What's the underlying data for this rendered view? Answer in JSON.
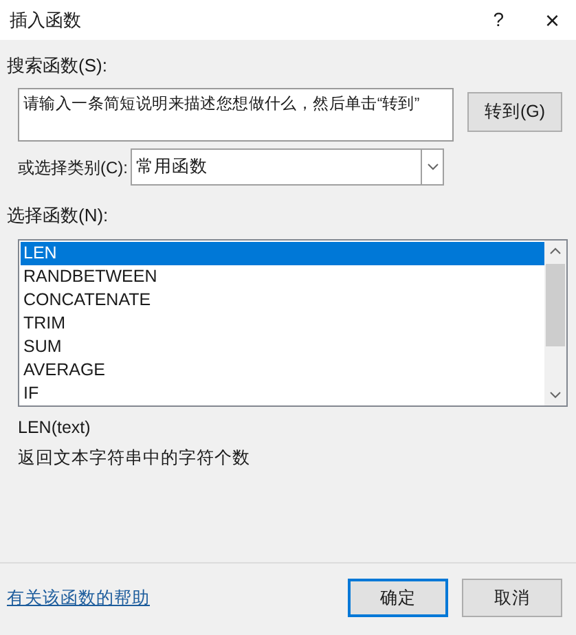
{
  "window": {
    "title": "插入函数",
    "help": "?",
    "close": "×"
  },
  "search": {
    "label": "搜索函数(S):",
    "value": "请输入一条简短说明来描述您想做什么，然后单击“转到”",
    "go_button": "转到(G)"
  },
  "category": {
    "label": "或选择类别(C):",
    "value": "常用函数"
  },
  "functions": {
    "label": "选择函数(N):",
    "items": [
      {
        "name": "LEN",
        "selected": true
      },
      {
        "name": "RANDBETWEEN",
        "selected": false
      },
      {
        "name": "CONCATENATE",
        "selected": false
      },
      {
        "name": "TRIM",
        "selected": false
      },
      {
        "name": "SUM",
        "selected": false
      },
      {
        "name": "AVERAGE",
        "selected": false
      },
      {
        "name": "IF",
        "selected": false
      }
    ]
  },
  "syntax": "LEN(text)",
  "description": "返回文本字符串中的字符个数",
  "help_link": "有关该函数的帮助",
  "buttons": [
    {
      "label": "确定",
      "default": true
    },
    {
      "label": "取消",
      "default": false
    }
  ]
}
